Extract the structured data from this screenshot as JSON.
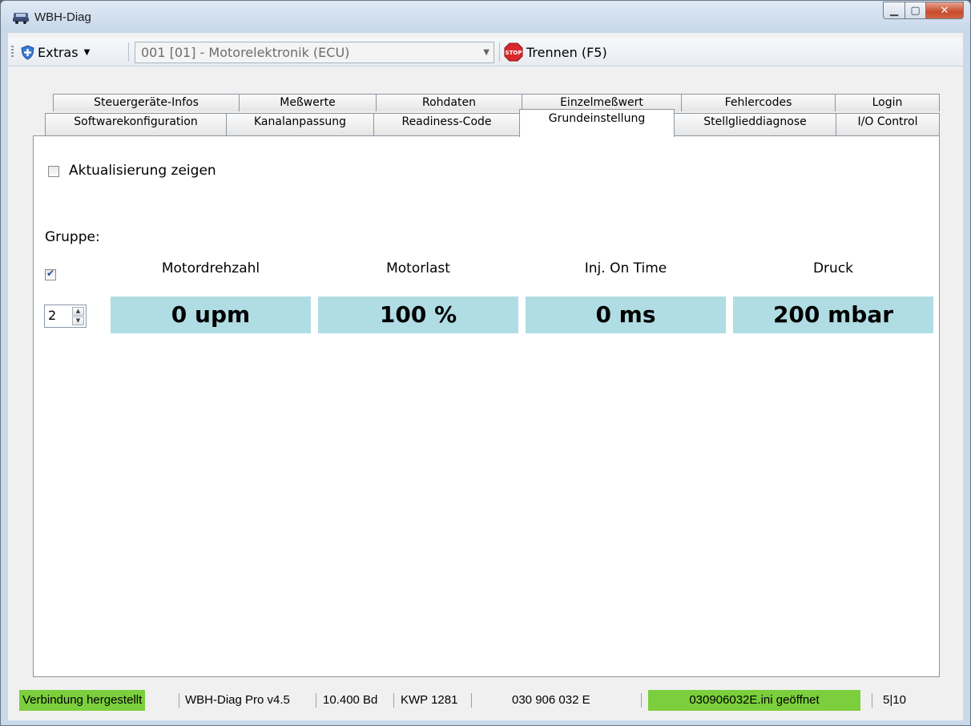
{
  "window": {
    "title": "WBH-Diag"
  },
  "toolbar": {
    "extras_label": "Extras",
    "ecu_select": "001 [01] - Motorelektronik (ECU)",
    "disconnect_label": "Trennen (F5)"
  },
  "tabs": {
    "row1": [
      "Steuergeräte-Infos",
      "Meßwerte",
      "Rohdaten",
      "Einzelmeßwert",
      "Fehlercodes",
      "Login"
    ],
    "row2": [
      "Softwarekonfiguration",
      "Kanalanpassung",
      "Readiness-Code",
      "Grundeinstellung",
      "Stellglieddiagnose",
      "I/O Control"
    ],
    "active": "Grundeinstellung"
  },
  "panel": {
    "show_update_label": "Aktualisierung zeigen",
    "show_update_checked": false,
    "group_label": "Gruppe:",
    "group_checked": true,
    "group_value": "2",
    "columns": [
      {
        "header": "Motordrehzahl",
        "value": "0 upm"
      },
      {
        "header": "Motorlast",
        "value": "100 %"
      },
      {
        "header": "Inj. On Time",
        "value": "0 ms"
      },
      {
        "header": "Druck",
        "value": "200 mbar"
      }
    ]
  },
  "status": {
    "connection": "Verbindung hergestellt",
    "version": "WBH-Diag Pro v4.5",
    "baud": "10.400 Bd",
    "protocol": "KWP 1281",
    "part_number": "030 906 032 E",
    "file": "030906032E.ini geöffnet",
    "counter": "5|10"
  },
  "colors": {
    "value_bg": "#b0dde4",
    "status_green": "#7ccf3c",
    "title_bg": "#c6d7ea"
  }
}
